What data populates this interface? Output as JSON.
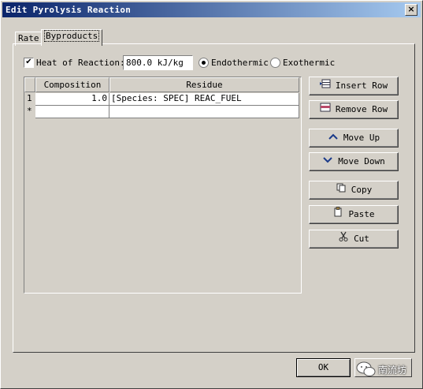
{
  "window": {
    "title": "Edit Pyrolysis Reaction",
    "close_glyph": "×"
  },
  "tabs": [
    {
      "label": "Rate"
    },
    {
      "label": "Byproducts"
    }
  ],
  "heat": {
    "checkbox_checked": true,
    "check_glyph": "✔",
    "label": "Heat of Reaction:",
    "value": "800.0 kJ/kg",
    "endothermic_label": "Endothermic",
    "exothermic_label": "Exothermic",
    "selected": "Endothermic"
  },
  "table": {
    "columns": [
      "Composition",
      "Residue"
    ],
    "rows": [
      {
        "marker": "1",
        "composition": "1.0",
        "residue": "[Species: SPEC] REAC_FUEL"
      },
      {
        "marker": "*",
        "composition": "",
        "residue": ""
      }
    ]
  },
  "side_buttons": {
    "insert_row": "Insert Row",
    "remove_row": "Remove Row",
    "move_up": "Move Up",
    "move_down": "Move Down",
    "copy": "Copy",
    "paste": "Paste",
    "cut": "Cut"
  },
  "footer": {
    "ok_label": "OK"
  },
  "watermark": {
    "text": "南流坊"
  }
}
